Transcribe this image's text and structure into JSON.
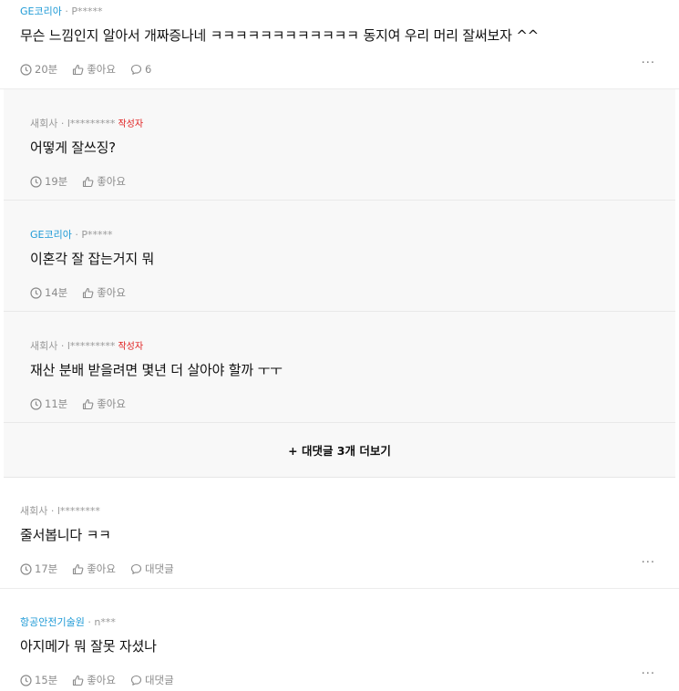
{
  "comments": [
    {
      "company": "GE코리아",
      "user": "P*****",
      "text": "무슨 느낌인지 알아서 개짜증나네 ㅋㅋㅋㅋㅋㅋㅋㅋㅋㅋㅋㅋ 동지여 우리 머리 잘써보자 ^^",
      "time": "20분",
      "like": "좋아요",
      "replies": "6",
      "more": "···"
    },
    {
      "company": "새회사",
      "user": "l********",
      "text": "줄서봅니다 ㅋㅋ",
      "time": "17분",
      "like": "좋아요",
      "reply": "대댓글",
      "more": "···"
    },
    {
      "company": "항공안전기술원",
      "user": "n***",
      "text": "아지메가 뭐 잘못 자셨나",
      "time": "15분",
      "like": "좋아요",
      "reply": "대댓글",
      "more": "···"
    }
  ],
  "replies": [
    {
      "company": "새회사",
      "user": "l*********",
      "author": "작성자",
      "text": "어떻게 잘쓰징?",
      "time": "19분",
      "like": "좋아요"
    },
    {
      "company": "GE코리아",
      "user": "P*****",
      "text": "이혼각 잘 잡는거지 뭐",
      "time": "14분",
      "like": "좋아요"
    },
    {
      "company": "새회사",
      "user": "l*********",
      "author": "작성자",
      "text": "재산 분배 받을려면 몇년 더 살아야 할까 ㅜㅜ",
      "time": "11분",
      "like": "좋아요"
    }
  ],
  "more_replies": "+ 대댓글 3개 더보기",
  "separator": " · "
}
